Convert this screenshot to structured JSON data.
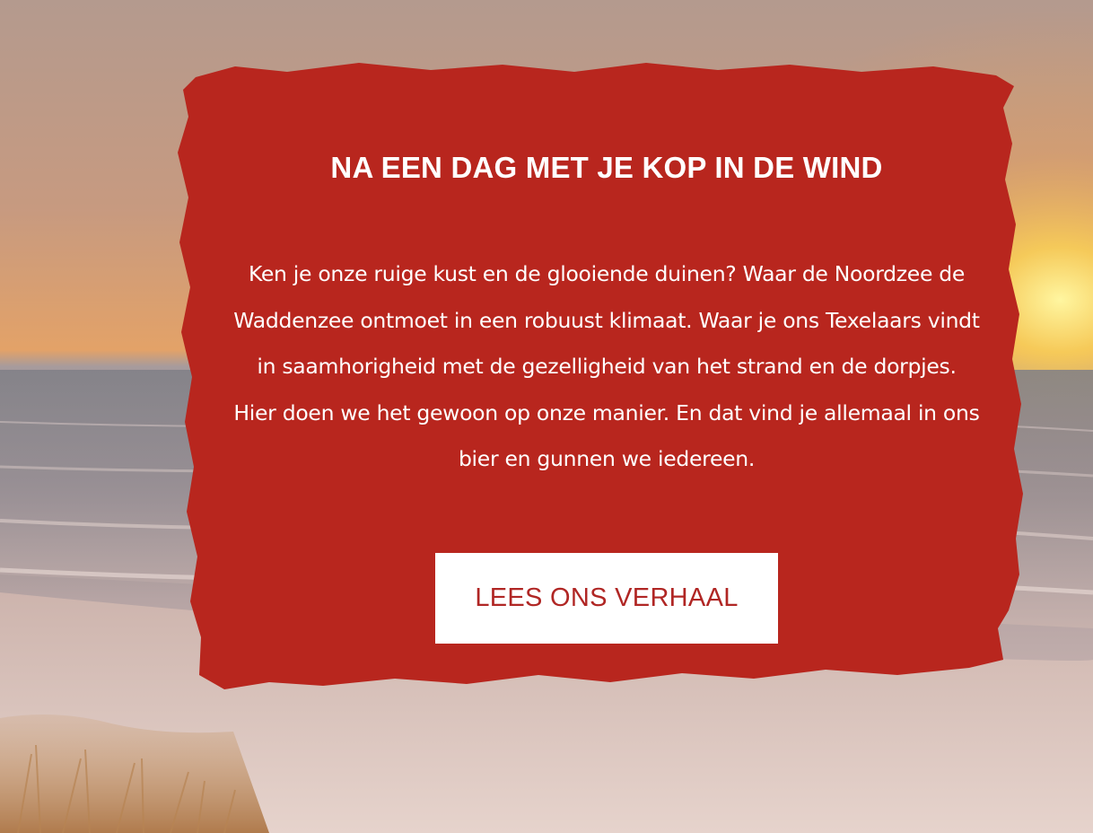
{
  "hero": {
    "title": "NA EEN DAG MET JE KOP IN DE WIND",
    "body": "Ken je onze ruige kust en de glooiende duinen? Waar de Noordzee de Waddenzee ontmoet in een robuust klimaat. Waar je ons Texelaars vindt in saamhorigheid met de gezelligheid van het strand en de dorpjes. Hier doen we het gewoon op onze manier. En dat vind je allemaal in ons bier en gunnen we iedereen.",
    "cta_label": "LEES ONS VERHAAL"
  },
  "colors": {
    "panel": "#b8261e",
    "button_bg": "#ffffff",
    "button_text": "#b02624",
    "heading_text": "#ffffff"
  }
}
